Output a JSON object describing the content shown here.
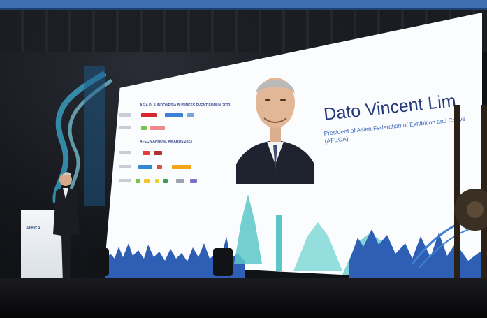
{
  "speaker": {
    "name": "Dato Vincent Lim",
    "title_line1": "President of Asian Federation of Exhibition and Conve",
    "title_line2": "(AFECA)"
  },
  "screen_panel": {
    "forum_title": "ASIA DI & INDONESIA BUSINESS EVENT FORUM 2023",
    "awards_title": "AFECA ANNUAL AWARDS 2023"
  },
  "podium_label": "AFECA",
  "colors": {
    "screen": "#fbfcfe",
    "skyline_blue": "#2f5fb5",
    "skyline_teal": "#5cc7c9",
    "name_navy": "#253a7a",
    "top_bar": "#3f6fb0"
  }
}
